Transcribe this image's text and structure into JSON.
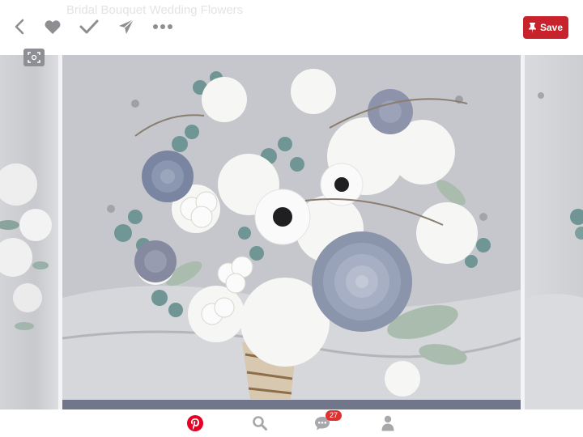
{
  "header": {
    "faded_title": "Bridal Bouquet Wedding Flowers",
    "save_label": "Save"
  },
  "toolbar_icons": [
    "back-chevron-icon",
    "heart-icon",
    "checkmark-icon",
    "send-icon",
    "more-dots-icon",
    "pin-icon"
  ],
  "pin": {
    "image_subject": "bouquet",
    "bar_color": "#71768a"
  },
  "bottom_nav": {
    "items": [
      "pinterest-logo-icon",
      "search-icon",
      "notifications-icon",
      "profile-icon"
    ],
    "notifications_count": "27"
  },
  "colors": {
    "save_button": "#c8232c",
    "badge": "#e0302f",
    "pinterest_red": "#e60023",
    "icon_gray": "#8e8e93"
  }
}
